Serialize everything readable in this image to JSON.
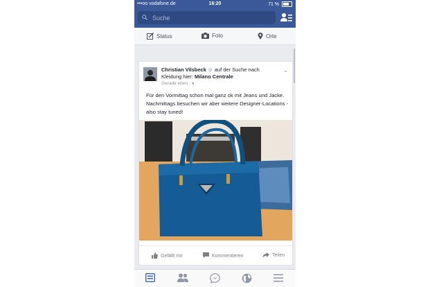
{
  "status_bar": {
    "carrier": "•••oo vodafone.de",
    "time": "16:20",
    "battery": "71 %",
    "battery_level": 0.71
  },
  "search": {
    "placeholder": "Suche"
  },
  "composer": {
    "status_label": "Status",
    "photo_label": "Foto",
    "places_label": "Orte"
  },
  "post": {
    "author": "Christian Vilsbeck",
    "activity": "auf der Suche nach Kleidung hier:",
    "place": "Milano Centrale",
    "time": "Gerade eben",
    "text": "Für den Vormittag schon mal ganz ok mit Jeans und Jacke. Nachmittags besuchen wir aber weitere Designer-Locations - also stay tuned!",
    "actions": {
      "like": "Gefällt mir",
      "comment": "Kommentieren",
      "share": "Teilen"
    }
  },
  "tabs": [
    "news-feed",
    "friend-requests",
    "messenger",
    "notifications",
    "more"
  ],
  "colors": {
    "brand": "#3b5998",
    "active_tab": "#4267b2",
    "inactive_tab": "#9197a3"
  }
}
